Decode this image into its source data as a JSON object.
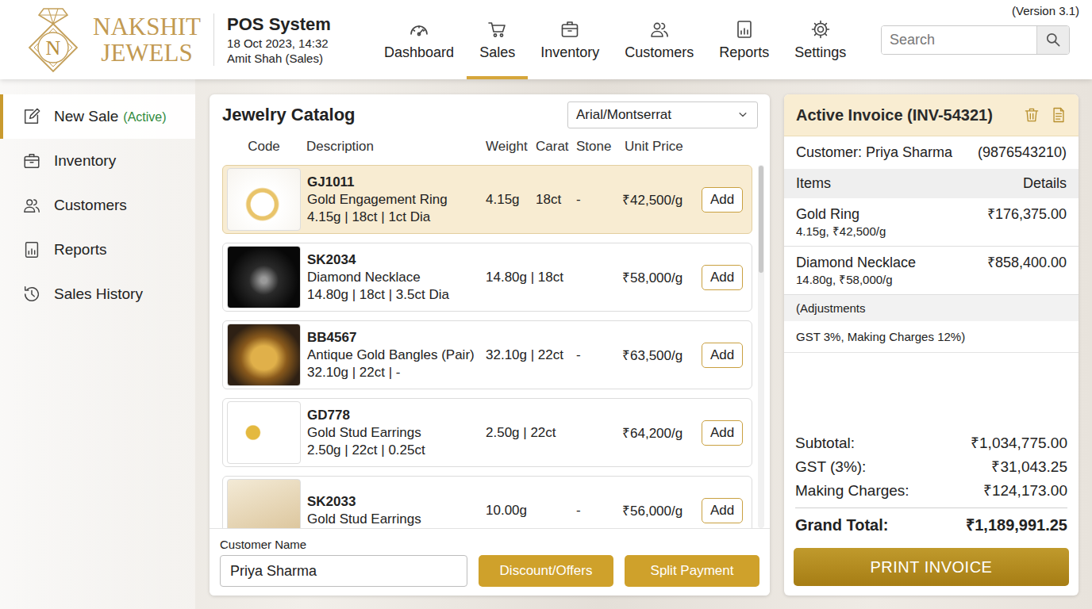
{
  "logo": {
    "monogram": "N",
    "name": "NAKSHIT",
    "tagline": "JEWELS"
  },
  "header": {
    "title": "POS System",
    "datetime": "18 Oct 2023, 14:32",
    "user": "Amit Shah (Sales)",
    "version": "(Version 3.1)"
  },
  "nav": [
    {
      "label": "Dashboard",
      "selected": false
    },
    {
      "label": "Sales",
      "selected": true
    },
    {
      "label": "Inventory",
      "selected": false
    },
    {
      "label": "Customers",
      "selected": false
    },
    {
      "label": "Reports",
      "selected": false
    },
    {
      "label": "Settings",
      "selected": false
    }
  ],
  "search": {
    "placeholder": "Search"
  },
  "sidebar": {
    "items": [
      {
        "label": "New Sale",
        "badge": "(Active)",
        "selected": true
      },
      {
        "label": "Inventory",
        "badge": "",
        "selected": false
      },
      {
        "label": "Customers",
        "badge": "",
        "selected": false
      },
      {
        "label": "Reports",
        "badge": "",
        "selected": false
      },
      {
        "label": "Sales History",
        "badge": "",
        "selected": false
      }
    ]
  },
  "catalog": {
    "title": "Jewelry Catalog",
    "font_select": "Arial/Montserrat",
    "columns": [
      "Code",
      "Description",
      "Weight",
      "Carat",
      "Stone",
      "Unit Price"
    ],
    "rows": [
      {
        "code": "GJ1011",
        "name": "Gold Engagement Ring",
        "specs": "4.15g | 18ct | 1ct Dia",
        "weight": "4.15g",
        "carat": "18ct",
        "stone": "-",
        "price": "₹42,500/g",
        "button": "Add",
        "selected": true
      },
      {
        "code": "SK2034",
        "name": "Diamond Necklace",
        "specs": "14.80g | 18ct | 3.5ct Dia",
        "weight": "14.80g | 18ct",
        "carat": "",
        "stone": "",
        "price": "₹58,000/g",
        "button": "Add",
        "selected": false
      },
      {
        "code": "BB4567",
        "name": "Antique Gold Bangles (Pair)",
        "specs": "32.10g | 22ct | -",
        "weight": "32.10g | 22ct",
        "carat": "",
        "stone": "-",
        "price": "₹63,500/g",
        "button": "Add",
        "selected": false
      },
      {
        "code": "GD778",
        "name": "Gold Stud Earrings",
        "specs": "2.50g | 22ct | 0.25ct",
        "weight": "2.50g | 22ct",
        "carat": "",
        "stone": "",
        "price": "₹64,200/g",
        "button": "Add",
        "selected": false
      },
      {
        "code": "SK2033",
        "name": "Gold Stud Earrings",
        "specs": "",
        "weight": "10.00g",
        "carat": "",
        "stone": "-",
        "price": "₹56,000/g",
        "button": "Add",
        "selected": false
      }
    ]
  },
  "customer_field": {
    "label": "Customer Name",
    "value": "Priya Sharma"
  },
  "actions": [
    "Discount/Offers",
    "Split Payment"
  ],
  "invoice": {
    "title": "Active Invoice (INV-54321)",
    "customer": "Customer: Priya Sharma",
    "phone": "(9876543210)",
    "columns": [
      "Items",
      "Details"
    ],
    "items": [
      {
        "name": "Gold Ring",
        "detail": "4.15g, ₹42,500/g",
        "amount": "₹176,375.00"
      },
      {
        "name": "Diamond Necklace",
        "detail": "14.80g, ₹58,000/g",
        "amount": "₹858,400.00"
      }
    ],
    "adjustments": [
      "(Adjustments",
      "GST 3%, Making Charges 12%)"
    ],
    "totals": [
      {
        "label": "Subtotal:",
        "value": "₹1,034,775.00",
        "kind": "line"
      },
      {
        "label": "GST (3%):",
        "value": "₹31,043.25",
        "kind": "line"
      },
      {
        "label": "Making Charges:",
        "value": "₹124,173.00",
        "kind": "line"
      },
      {
        "label": "Grand Total:",
        "value": "₹1,189,991.25",
        "kind": "grand"
      }
    ],
    "print": "PRINT INVOICE"
  }
}
